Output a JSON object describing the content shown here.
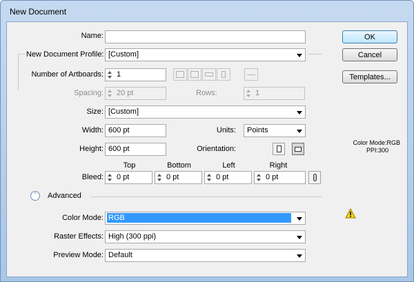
{
  "window": {
    "title": "New Document"
  },
  "form": {
    "name": {
      "label": "Name:",
      "value": ""
    },
    "profile": {
      "label": "New Document Profile:",
      "value": "[Custom]"
    },
    "artboards": {
      "label": "Number of Artboards:",
      "value": "1"
    },
    "spacing": {
      "label": "Spacing:",
      "value": "20 pt"
    },
    "rows": {
      "label": "Rows:",
      "value": "1"
    },
    "size": {
      "label": "Size:",
      "value": "[Custom]"
    },
    "width": {
      "label": "Width:",
      "value": "600 pt"
    },
    "units": {
      "label": "Units:",
      "value": "Points"
    },
    "height": {
      "label": "Height:",
      "value": "600 pt"
    },
    "orientation": {
      "label": "Orientation:",
      "selected": "landscape"
    },
    "bleed": {
      "label": "Bleed:",
      "top": {
        "label": "Top",
        "value": "0 pt"
      },
      "bottom": {
        "label": "Bottom",
        "value": "0 pt"
      },
      "left": {
        "label": "Left",
        "value": "0 pt"
      },
      "right": {
        "label": "Right",
        "value": "0 pt"
      }
    },
    "advanced": {
      "label": "Advanced",
      "color_mode": {
        "label": "Color Mode:",
        "value": "RGB"
      },
      "raster_effects": {
        "label": "Raster Effects:",
        "value": "High (300 ppi)"
      },
      "preview_mode": {
        "label": "Preview Mode:",
        "value": "Default"
      }
    }
  },
  "buttons": {
    "ok": "OK",
    "cancel": "Cancel",
    "templates": "Templates..."
  },
  "info": {
    "color_mode": "Color Mode:RGB",
    "ppi": "PPI:300"
  },
  "icons": [
    "grid-by-row-icon",
    "grid-by-column-icon",
    "arrange-by-row-icon",
    "arrange-by-column-icon",
    "right-to-left-icon",
    "portrait-icon",
    "landscape-icon",
    "link-bleed-icon",
    "collapse-advanced-icon",
    "warning-icon"
  ],
  "colors": {
    "selection": "#3399ff",
    "warning": "#f3d21b"
  }
}
